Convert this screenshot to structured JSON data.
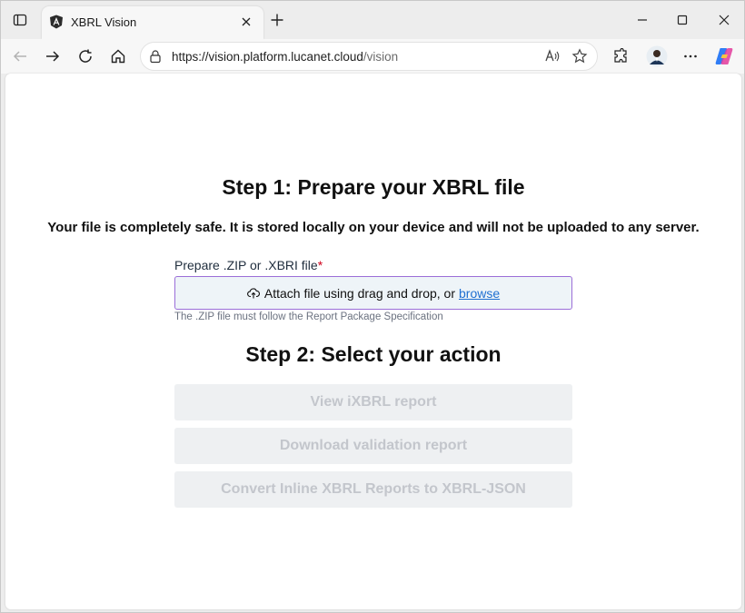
{
  "browser": {
    "tab_title": "XBRL Vision",
    "url_host": "https://vision.platform.lucanet.cloud",
    "url_path": "/vision"
  },
  "page": {
    "step1_title": "Step 1: Prepare your XBRL file",
    "safety_note": "Your file is completely safe. It is stored locally on your device and will not be uploaded to any server.",
    "file_label": "Prepare .ZIP or .XBRI file",
    "required_mark": "*",
    "dropzone_text": "Attach file using drag and drop, or",
    "browse_label": "browse",
    "hint": "The .ZIP file must follow the Report Package Specification",
    "step2_title": "Step 2: Select your action",
    "actions": [
      {
        "label": "View iXBRL report",
        "enabled": false
      },
      {
        "label": "Download validation report",
        "enabled": false
      },
      {
        "label": "Convert Inline XBRL Reports to XBRL-JSON",
        "enabled": false
      }
    ]
  },
  "icons": {
    "tab_actions": "tab-actions-icon",
    "favicon": "angular-icon",
    "lock": "lock-icon",
    "upload": "upload-icon"
  },
  "colors": {
    "browse_link": "#1f6fd1",
    "dropzone_border": "#9b6ed8",
    "required": "#d0021b"
  }
}
